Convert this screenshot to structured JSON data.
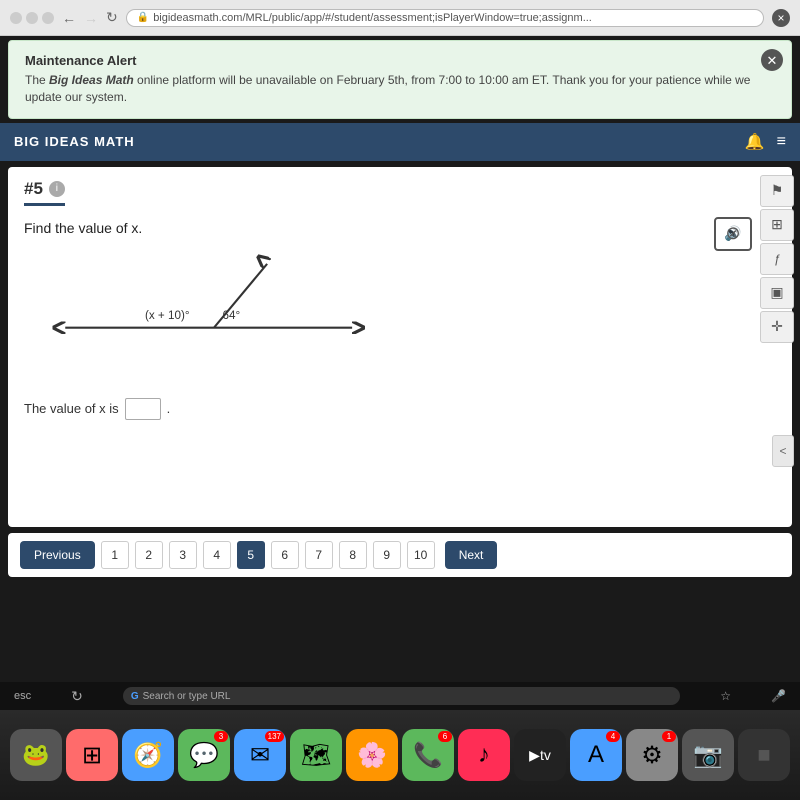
{
  "browser": {
    "url": "bigideasmath.com/MRL/public/app/#/student/assessment;isPlayerWindow=true;assignm...",
    "lock_symbol": "🔒"
  },
  "alert": {
    "title": "Maintenance Alert",
    "body_prefix": "The ",
    "brand": "Big Ideas Math",
    "body_suffix": " online platform will be unavailable on February 5th, from 7:00 to 10:00 am ET. Thank you for your patience while we update our system.",
    "close_label": "✕"
  },
  "header": {
    "logo": "BIG IDEAS MATH",
    "bell_icon": "🔔",
    "menu_icon": "≡"
  },
  "question": {
    "number": "#5",
    "info": "i",
    "text": "Find the value of x.",
    "angle1_label": "(x + 10)°",
    "angle2_label": "64°",
    "answer_prefix": "The value of x is",
    "answer_suffix": "."
  },
  "tools": {
    "flag_icon": "⚑",
    "calc_icon": "▦",
    "formula_icon": "ƒ",
    "calendar_icon": "▣",
    "accessibility_icon": "♿"
  },
  "media_btn": {
    "icon": "🔇"
  },
  "collapse_btn": {
    "label": "<"
  },
  "nav": {
    "prev_label": "Previous",
    "next_label": "Next",
    "pages": [
      "1",
      "2",
      "3",
      "4",
      "5",
      "6",
      "7",
      "8",
      "9",
      "10"
    ],
    "active_page": "5"
  },
  "esc_bar": {
    "esc_label": "esc",
    "search_placeholder": "Search or type URL"
  },
  "dock": [
    {
      "icon": "🍎",
      "color": "#555",
      "badge": null
    },
    {
      "icon": "⊞",
      "color": "#ff6b6b",
      "badge": null
    },
    {
      "icon": "🧭",
      "color": "#4a9eff",
      "badge": null
    },
    {
      "icon": "💬",
      "color": "#5cb85c",
      "badge": "3"
    },
    {
      "icon": "✉",
      "color": "#4a9eff",
      "badge": "137"
    },
    {
      "icon": "🗺",
      "color": "#5cb85c",
      "badge": null
    },
    {
      "icon": "🖼",
      "color": "#ff9500",
      "badge": null
    },
    {
      "icon": "📞",
      "color": "#5cb85c",
      "badge": "6"
    },
    {
      "icon": "🎵",
      "color": "#ff9500",
      "badge": null
    },
    {
      "icon": "📺",
      "color": "#333",
      "badge": null
    },
    {
      "icon": "⬆",
      "color": "#4a9eff",
      "badge": "4"
    },
    {
      "icon": "⚙",
      "color": "#888",
      "badge": "1"
    },
    {
      "icon": "📷",
      "color": "#555",
      "badge": null
    },
    {
      "icon": "■",
      "color": "#333",
      "badge": null
    }
  ]
}
